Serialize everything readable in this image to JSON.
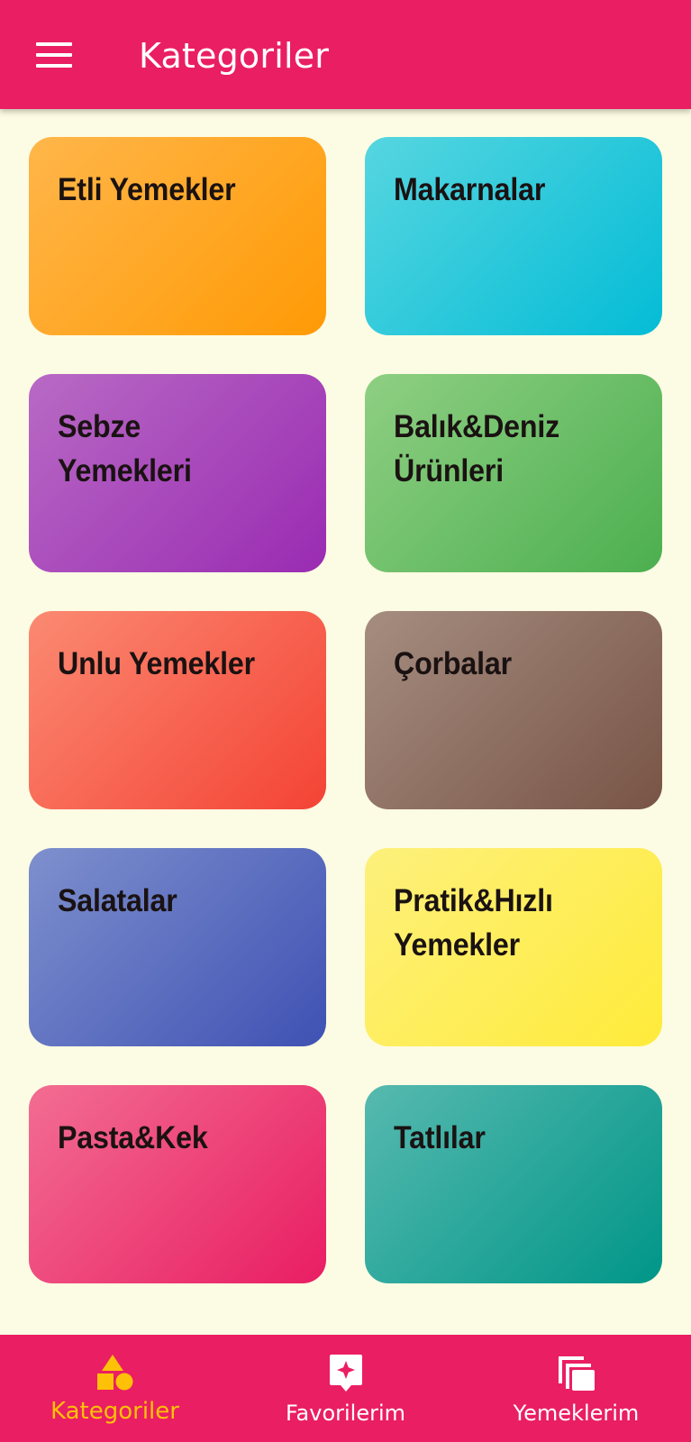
{
  "appbar": {
    "title": "Kategoriler",
    "menu_icon": "hamburger-menu-icon"
  },
  "categories": [
    {
      "label": "Etli Yemekler"
    },
    {
      "label": "Makarnalar"
    },
    {
      "label": "Sebze Yemekleri"
    },
    {
      "label": "Balık&Deniz Ürünleri"
    },
    {
      "label": "Unlu Yemekler"
    },
    {
      "label": "Çorbalar"
    },
    {
      "label": "Salatalar"
    },
    {
      "label": "Pratik&Hızlı Yemekler"
    },
    {
      "label": "Pasta&Kek"
    },
    {
      "label": "Tatlılar"
    }
  ],
  "bottom_nav": {
    "items": [
      {
        "label": "Kategoriler",
        "icon": "shapes-icon",
        "active": true
      },
      {
        "label": "Favorilerim",
        "icon": "favorites-star-icon",
        "active": false
      },
      {
        "label": "Yemeklerim",
        "icon": "library-stack-icon",
        "active": false
      }
    ]
  },
  "colors": {
    "appbar": "#ea1e63",
    "background": "#fcfbe3",
    "active_nav": "#ffc107"
  }
}
